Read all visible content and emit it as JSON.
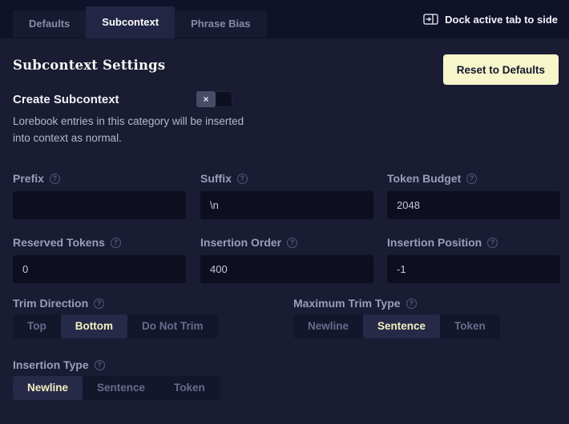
{
  "colors": {
    "background": "#191C33",
    "topbar": "#10122A",
    "input_background": "#0D0E20",
    "tab_active_bg": "#232544",
    "segment_selected_bg": "#262947",
    "segment_selected_text": "#F2F0C2",
    "accent_cream": "#F5F3C2",
    "reset_button_bg": "#F7F6CB",
    "reset_button_text": "#14162C",
    "label_gray": "#9A9EB8"
  },
  "icons": {
    "help": "?",
    "dock": "dock-panel-right-icon",
    "toggle_off_glyph": "×"
  },
  "tabs": {
    "items": [
      {
        "label": "Defaults",
        "active": false
      },
      {
        "label": "Subcontext",
        "active": true
      },
      {
        "label": "Phrase Bias",
        "active": false
      }
    ],
    "dock_label": "Dock active tab to side"
  },
  "header": {
    "title": "Subcontext Settings",
    "reset_button_label": "Reset to Defaults"
  },
  "create_subcontext": {
    "label": "Create Subcontext",
    "toggle_state": "off",
    "toggle_glyph": "×",
    "description_lines": [
      "Lorebook entries in this category will be inserted",
      "into context as normal."
    ]
  },
  "fields": [
    {
      "label": "Prefix",
      "value": ""
    },
    {
      "label": "Suffix",
      "value": "\\n"
    },
    {
      "label": "Token Budget",
      "value": "2048"
    },
    {
      "label": "Reserved Tokens",
      "value": "0"
    },
    {
      "label": "Insertion Order",
      "value": "400"
    },
    {
      "label": "Insertion Position",
      "value": "-1"
    }
  ],
  "segmented": [
    {
      "label": "Trim Direction",
      "options": [
        "Top",
        "Bottom",
        "Do Not Trim"
      ],
      "selected": "Bottom"
    },
    {
      "label": "Maximum Trim Type",
      "options": [
        "Newline",
        "Sentence",
        "Token"
      ],
      "selected": "Sentence"
    },
    {
      "label": "Insertion Type",
      "options": [
        "Newline",
        "Sentence",
        "Token"
      ],
      "selected": "Newline"
    }
  ]
}
